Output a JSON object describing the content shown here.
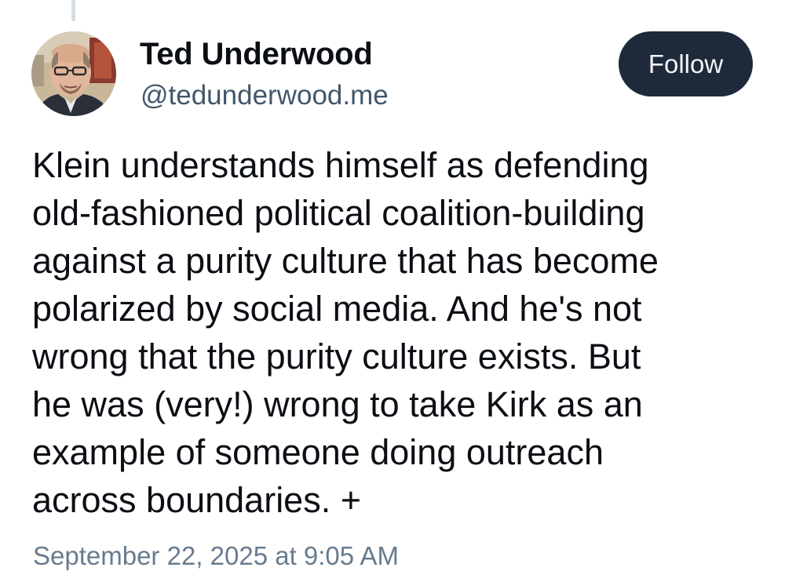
{
  "post": {
    "author": {
      "name": "Ted Underwood",
      "handle": "@tedunderwood.me"
    },
    "follow_label": "Follow",
    "text_lines": [
      "Klein understands himself as defending",
      "old-fashioned political coalition-building",
      "against a purity culture that has become",
      "polarized by social media. And he's not",
      "wrong that the purity culture exists. But",
      "he was (very!) wrong to take Kirk as an",
      "example of someone doing outreach",
      "across boundaries. +"
    ],
    "timestamp": "September 22, 2025 at 9:05 AM"
  },
  "colors": {
    "follow_bg": "#1e2a3a",
    "handle": "#42576c",
    "text": "#0b0f14"
  }
}
